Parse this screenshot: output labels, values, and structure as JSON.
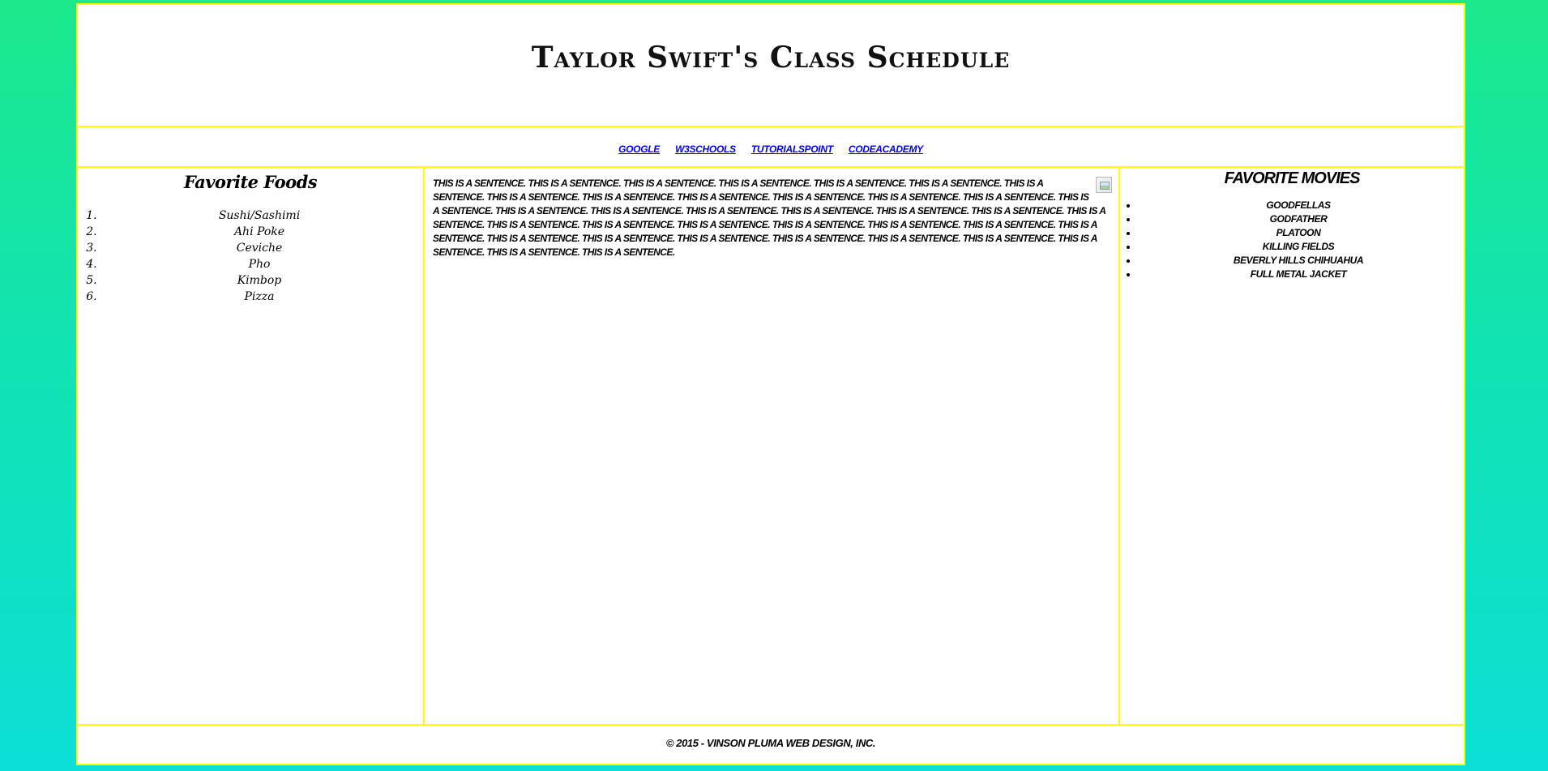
{
  "header": {
    "title": "Taylor Swift's Class Schedule"
  },
  "nav": {
    "links": [
      "Google",
      "W3Schools",
      "Tutorialspoint",
      "Codeacademy"
    ]
  },
  "foods": {
    "heading": "Favorite Foods",
    "items": [
      "Sushi/Sashimi",
      "Ahi Poke",
      "Ceviche",
      "Pho",
      "Kimbop",
      "Pizza"
    ]
  },
  "main": {
    "image_icon": "broken-image-icon",
    "paragraph": "This is a sentence. This is a sentence. This is a sentence. This is a sentence. This is a sentence. This is a sentence. This is a sentence. This is a sentence. This is a sentence. This is a sentence. This is a sentence. This is a sentence. This is a sentence. This is a sentence. This is a sentence. This is a sentence. This is a sentence. This is a sentence. This is a sentence. This is a sentence. This is a sentence. This is a sentence. This is a sentence. This is a sentence. This is a sentence. This is a sentence. This is a sentence. This is a sentence. This is a sentence. This is a sentence. This is a sentence. This is a sentence. This is a sentence. This is a sentence. This is a sentence. This is a sentence. This is a sentence."
  },
  "movies": {
    "heading": "Favorite Movies",
    "items": [
      "Goodfellas",
      "Godfather",
      "Platoon",
      "Killing Fields",
      "Beverly Hills Chihuahua",
      "Full Metal Jacket"
    ]
  },
  "footer": {
    "text": "© 2015 - Vinson Pluma Web Design, Inc."
  },
  "colors": {
    "border": "#ffff00",
    "link": "#0000ee",
    "background_top": "#1ce98c",
    "background_bottom": "#0cdfd6"
  }
}
